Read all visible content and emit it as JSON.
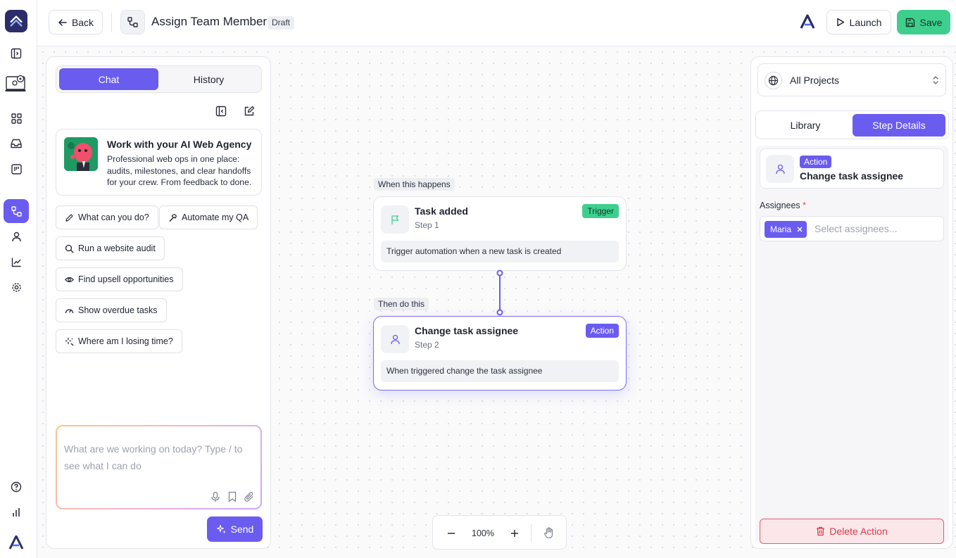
{
  "header": {
    "back_label": "Back",
    "title": "Assign Team Member",
    "status_badge": "Draft",
    "launch_label": "Launch",
    "save_label": "Save"
  },
  "chat": {
    "tabs": [
      {
        "label": "Chat",
        "active": true
      },
      {
        "label": "History",
        "active": false
      }
    ],
    "agency_card": {
      "title": "Work with your AI Web Agency",
      "description": "Professional web ops in one place: audits, milestones, and clear handoffs for your crew. From feedback to done."
    },
    "suggestions": [
      {
        "label": "What can you do?",
        "icon": "pencil-icon"
      },
      {
        "label": "Automate my QA",
        "icon": "hammer-icon"
      },
      {
        "label": "Run a website audit",
        "icon": "search-icon"
      },
      {
        "label": "Find upsell opportunities",
        "icon": "eye-icon"
      },
      {
        "label": "Show overdue tasks",
        "icon": "gauge-icon"
      },
      {
        "label": "Where am I losing time?",
        "icon": "sparkle-icon"
      }
    ],
    "composer_placeholder": "What are we working on today? Type / to see what I can do",
    "send_label": "Send"
  },
  "flow": {
    "trigger_caption": "When this happens",
    "action_caption": "Then do this",
    "nodes": [
      {
        "title": "Task added",
        "step": "Step 1",
        "badge": "Trigger",
        "badge_color": "#3ecf8e",
        "description": "Trigger automation when a new task is created",
        "icon": "flag-icon"
      },
      {
        "title": "Change task assignee",
        "step": "Step 2",
        "badge": "Action",
        "badge_color": "#6b5cf0",
        "description": "When triggered change the task assignee",
        "icon": "user-icon"
      }
    ],
    "zoom": "100%"
  },
  "details": {
    "project_select": "All Projects",
    "tabs": [
      {
        "label": "Library",
        "active": false
      },
      {
        "label": "Step Details",
        "active": true
      }
    ],
    "step_badge": "Action",
    "step_name": "Change task assignee",
    "assignees_label": "Assignees",
    "required_mark": "*",
    "assignees": [
      "Maria"
    ],
    "assignees_placeholder": "Select assignees...",
    "delete_label": "Delete Action"
  },
  "colors": {
    "accent": "#6b5cf0",
    "success": "#3ecf8e",
    "danger": "#d83a4a"
  }
}
